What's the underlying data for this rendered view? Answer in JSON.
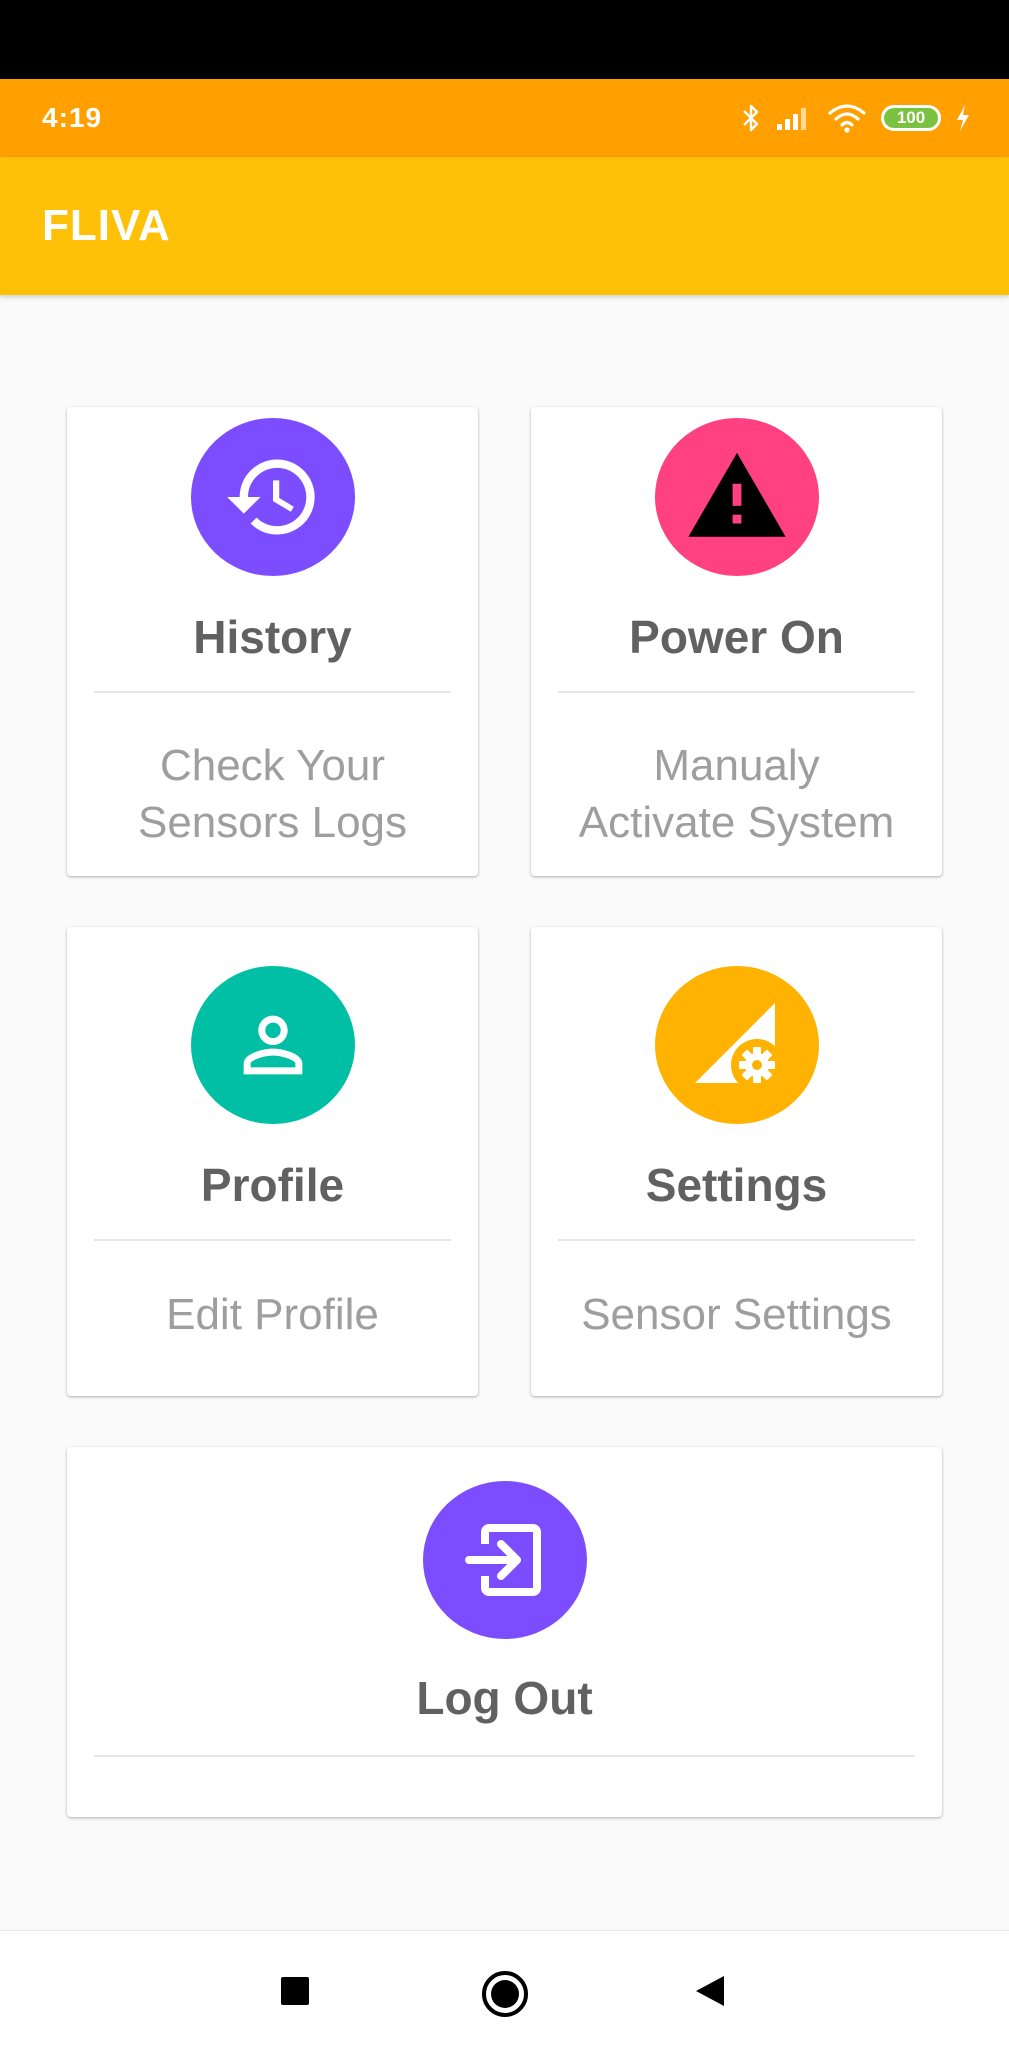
{
  "status_bar": {
    "time": "4:19",
    "battery": "100",
    "icons": [
      "bluetooth-icon",
      "signal-icon",
      "wifi-icon",
      "battery-icon",
      "charging-icon"
    ]
  },
  "app_bar": {
    "title": "FLIVA"
  },
  "cards": {
    "history": {
      "title": "History",
      "subtitle_line1": "Check Your",
      "subtitle_line2": "Sensors Logs",
      "icon": "history-icon",
      "color": "#7c4dff"
    },
    "power_on": {
      "title": "Power On",
      "subtitle_line1": "Manualy",
      "subtitle_line2": "Activate System",
      "icon": "warning-icon",
      "color": "#ff4081"
    },
    "profile": {
      "title": "Profile",
      "subtitle_line1": "Edit Profile",
      "icon": "person-icon",
      "color": "#00bfa5"
    },
    "settings": {
      "title": "Settings",
      "subtitle_line1": "Sensor Settings",
      "icon": "signal-settings-icon",
      "color": "#ffb300"
    },
    "logout": {
      "title": "Log Out",
      "icon": "exit-icon",
      "color": "#7c4dff"
    }
  },
  "nav_bar": {
    "icons": [
      "recents-square-icon",
      "home-circle-icon",
      "back-triangle-icon"
    ]
  }
}
